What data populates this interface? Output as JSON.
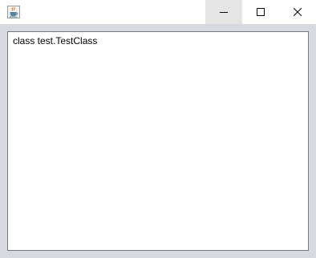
{
  "window": {
    "title": "",
    "icon": "java-cup-icon",
    "controls": {
      "minimize_icon": "minimize-icon",
      "maximize_icon": "maximize-icon",
      "close_icon": "close-icon"
    }
  },
  "text_area": {
    "content": "class test.TestClass"
  },
  "colors": {
    "title_bar": "#ffffff",
    "minimize_hover": "#e5e5e5",
    "content_background": "#d6d9df",
    "text_area_border": "#7a7a7a"
  }
}
